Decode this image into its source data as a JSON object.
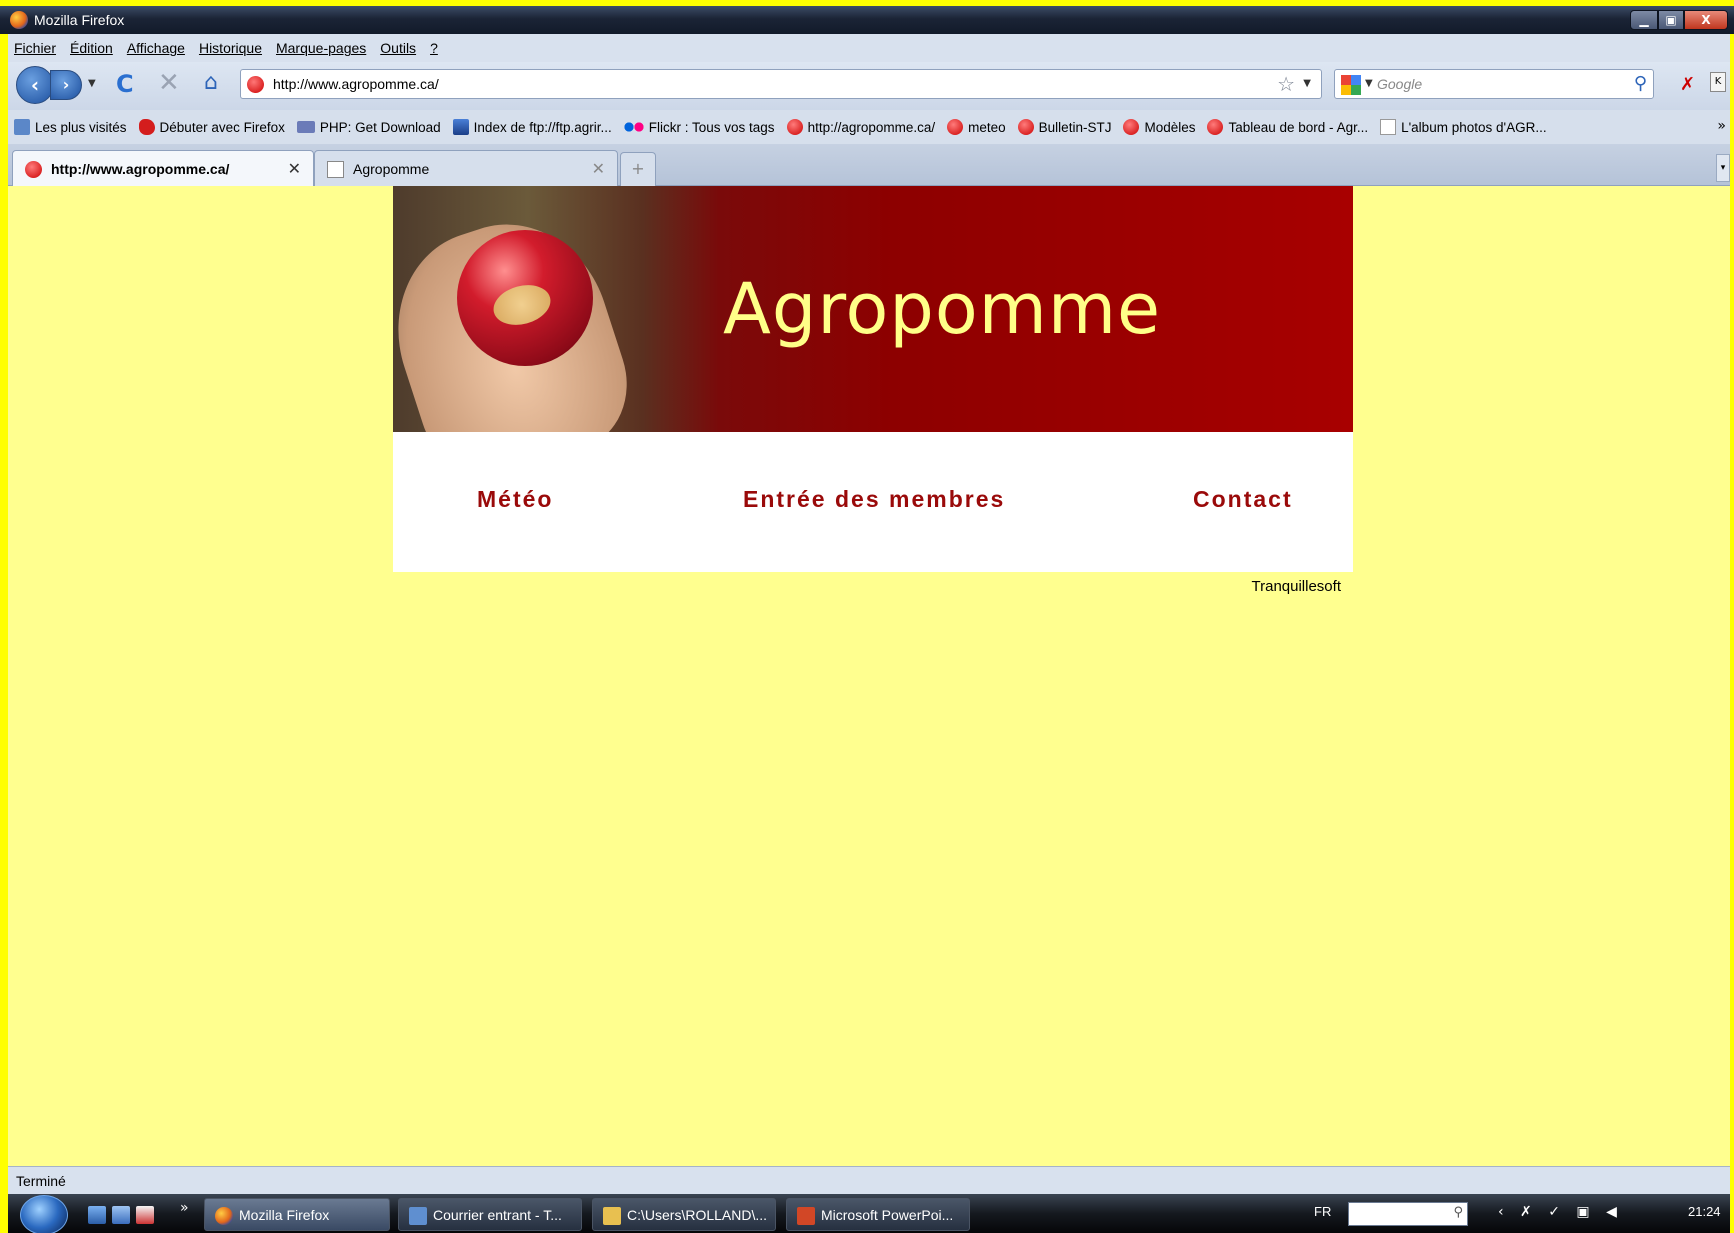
{
  "window": {
    "title": "Mozilla Firefox"
  },
  "menu": [
    "Fichier",
    "Édition",
    "Affichage",
    "Historique",
    "Marque-pages",
    "Outils",
    "?"
  ],
  "nav": {
    "url": "http://www.agropomme.ca/",
    "search_placeholder": "Google"
  },
  "bookmarks": [
    {
      "label": "Les plus visités",
      "icon": "search-icon"
    },
    {
      "label": "Débuter avec Firefox",
      "icon": "redbird-icon"
    },
    {
      "label": "PHP: Get Download",
      "icon": "php-icon"
    },
    {
      "label": "Index de ftp://ftp.agrir...",
      "icon": "computer-icon"
    },
    {
      "label": "Flickr : Tous vos tags",
      "icon": "flickr-icon"
    },
    {
      "label": "http://agropomme.ca/",
      "icon": "apple-icon"
    },
    {
      "label": "meteo",
      "icon": "apple-icon"
    },
    {
      "label": "Bulletin-STJ",
      "icon": "apple-icon"
    },
    {
      "label": "Modèles",
      "icon": "apple-icon"
    },
    {
      "label": "Tableau de bord - Agr...",
      "icon": "apple-icon"
    },
    {
      "label": "L'album photos d'AGR...",
      "icon": "document-icon"
    }
  ],
  "bookmarks_more": "»",
  "tabs": [
    {
      "label": "http://www.agropomme.ca/",
      "active": true
    },
    {
      "label": "Agropomme",
      "active": false
    }
  ],
  "page": {
    "title": "Agropomme",
    "nav_links": [
      "Météo",
      "Entrée des membres",
      "Contact"
    ],
    "credit": "Tranquillesoft"
  },
  "status": "Terminé",
  "taskbar": {
    "tasks": [
      "Mozilla Firefox",
      "Courrier entrant - T...",
      "C:\\Users\\ROLLAND\\...",
      "Microsoft PowerPoi..."
    ],
    "language": "FR",
    "clock": "21:24"
  },
  "colors": {
    "page_background": "#ffff8f",
    "banner_red": "#a80000",
    "title_yellow": "#ffff88",
    "nav_link_red": "#9a0a0a",
    "frame_yellow": "#ffff00"
  }
}
